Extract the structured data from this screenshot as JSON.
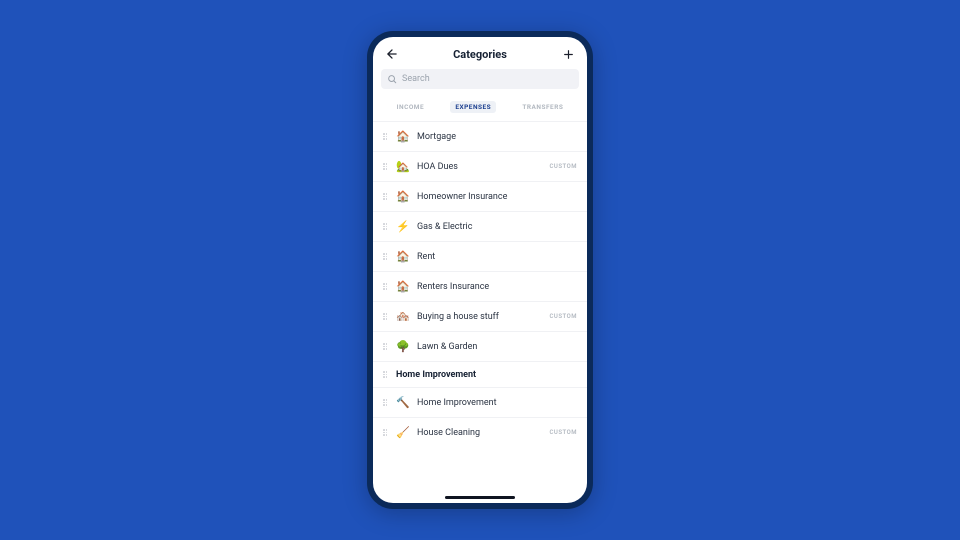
{
  "header": {
    "title": "Categories"
  },
  "search": {
    "placeholder": "Search"
  },
  "tabs": [
    {
      "key": "income",
      "label": "INCOME",
      "active": false
    },
    {
      "key": "expenses",
      "label": "EXPENSES",
      "active": true
    },
    {
      "key": "transfers",
      "label": "TRANSFERS",
      "active": false
    }
  ],
  "badge_custom": "CUSTOM",
  "items": [
    {
      "icon": "🏠",
      "label": "Mortgage",
      "custom": false
    },
    {
      "icon": "🏡",
      "label": "HOA Dues",
      "custom": true
    },
    {
      "icon": "🏠",
      "label": "Homeowner Insurance",
      "custom": false
    },
    {
      "icon": "⚡",
      "label": "Gas & Electric",
      "custom": false
    },
    {
      "icon": "🏠",
      "label": "Rent",
      "custom": false
    },
    {
      "icon": "🏠",
      "label": "Renters Insurance",
      "custom": false
    },
    {
      "icon": "🏘️",
      "label": "Buying a house stuff",
      "custom": true
    },
    {
      "icon": "🌳",
      "label": "Lawn & Garden",
      "custom": false
    }
  ],
  "section2": {
    "title": "Home Improvement",
    "items": [
      {
        "icon": "🔨",
        "label": "Home Improvement",
        "custom": false
      },
      {
        "icon": "🧹",
        "label": "House Cleaning",
        "custom": true
      }
    ]
  }
}
